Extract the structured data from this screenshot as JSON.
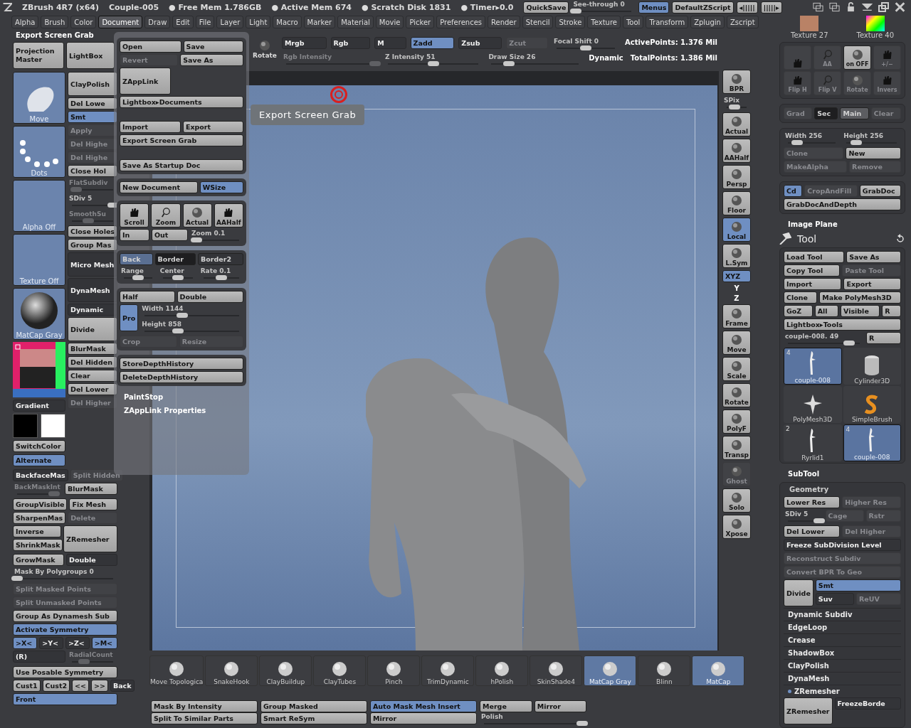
{
  "title_bar": {
    "app": "ZBrush 4R7 (x64)",
    "document": "Couple-005",
    "stats": [
      "● Free Mem 1.786GB",
      "● Active Mem 674",
      "● Scratch Disk 1831",
      "● Timer▸0.0"
    ],
    "controls": [
      {
        "kind": "button",
        "label": "QuickSave",
        "disabled": false
      },
      {
        "kind": "slider",
        "label": "See-through",
        "value": "0",
        "level": 0.0,
        "disabled": false
      },
      {
        "kind": "toggle",
        "label": "Menus",
        "on": true
      },
      {
        "kind": "button",
        "label": "DefaultZScript",
        "disabled": false
      },
      {
        "kind": "button",
        "label": "◂|||||",
        "disabled": false
      },
      {
        "kind": "button",
        "label": "|||||▸",
        "disabled": false
      }
    ]
  },
  "menu_bar": [
    {
      "label": "Alpha",
      "selected": false
    },
    {
      "label": "Brush",
      "selected": false
    },
    {
      "label": "Color",
      "selected": false
    },
    {
      "label": "Document",
      "selected": true
    },
    {
      "label": "Draw",
      "selected": false
    },
    {
      "label": "Edit",
      "selected": false
    },
    {
      "label": "File",
      "selected": false
    },
    {
      "label": "Layer",
      "selected": false
    },
    {
      "label": "Light",
      "selected": false
    },
    {
      "label": "Macro",
      "selected": false
    },
    {
      "label": "Marker",
      "selected": false
    },
    {
      "label": "Material",
      "selected": false
    },
    {
      "label": "Movie",
      "selected": false
    },
    {
      "label": "Picker",
      "selected": false
    },
    {
      "label": "Preferences",
      "selected": false
    },
    {
      "label": "Render",
      "selected": false
    },
    {
      "label": "Stencil",
      "selected": false
    },
    {
      "label": "Stroke",
      "selected": false
    },
    {
      "label": "Texture",
      "selected": false
    },
    {
      "label": "Tool",
      "selected": false
    },
    {
      "label": "Transform",
      "selected": false
    },
    {
      "label": "Zplugin",
      "selected": false
    },
    {
      "label": "Zscript",
      "selected": false
    }
  ],
  "left_palette": {
    "title": "Export Screen Grab",
    "top_row": [
      {
        "kind": "bigbutton",
        "label": "Projection Master",
        "disabled": false
      },
      {
        "kind": "bigbutton",
        "label": "LightBox",
        "disabled": false
      }
    ],
    "thumbnails": [
      {
        "kind": "brush-thumb",
        "label": "Move"
      },
      {
        "kind": "stroke-thumb",
        "label": "Dots"
      },
      {
        "kind": "alpha-thumb",
        "label": "Alpha Off"
      },
      {
        "kind": "texture-thumb",
        "label": "Texture Off"
      },
      {
        "kind": "material-thumb",
        "label": "MatCap Gray"
      },
      {
        "kind": "color-picker"
      },
      {
        "kind": "toggle",
        "label": "Gradient",
        "on": false
      },
      {
        "kind": "swatches"
      },
      {
        "kind": "button",
        "label": "SwitchColor",
        "disabled": false
      },
      {
        "kind": "toggle",
        "label": "Alternate",
        "on": true
      }
    ],
    "side_column": [
      {
        "kind": "bigbutton",
        "label": "ClayPolish",
        "disabled": false
      },
      {
        "kind": "button",
        "label": "Del Lowe",
        "disabled": false
      },
      {
        "kind": "toggle",
        "label": "Smt",
        "on": true
      },
      {
        "kind": "button",
        "label": "Apply",
        "disabled": true
      },
      {
        "kind": "button",
        "label": "Del Highe",
        "disabled": true
      },
      {
        "kind": "button",
        "label": "Del Highe",
        "disabled": true
      },
      {
        "kind": "button",
        "label": "Close Hol",
        "disabled": false
      },
      {
        "kind": "slider",
        "label": "FlatSubdiv",
        "level": 0.1,
        "disabled": true
      },
      {
        "kind": "slider",
        "label": "SDiv",
        "value": "5",
        "level": 1.0,
        "disabled": false
      },
      {
        "kind": "slider",
        "label": "SmoothSu",
        "level": 0.4,
        "disabled": true
      },
      {
        "kind": "button",
        "label": "Close Holes",
        "disabled": false
      },
      {
        "kind": "button",
        "label": "Group Mas",
        "disabled": false
      },
      {
        "kind": "bigtoggle",
        "label": "Micro Mesh",
        "on": false
      },
      {
        "kind": "bigtoggle",
        "label": "DynaMesh",
        "on": false
      },
      {
        "kind": "toggle",
        "label": "Dynamic",
        "on": false
      },
      {
        "kind": "bigbutton",
        "label": "Divide",
        "disabled": false
      },
      {
        "kind": "button",
        "label": "BlurMask",
        "disabled": false
      },
      {
        "kind": "button",
        "label": "Del Hidden",
        "disabled": false
      },
      {
        "kind": "button",
        "label": "Clear",
        "disabled": false
      },
      {
        "kind": "button",
        "label": "Del Lower",
        "disabled": false
      },
      {
        "kind": "button",
        "label": "Del Higher",
        "disabled": true
      }
    ],
    "lower_rows": [
      [
        {
          "kind": "toggle",
          "label": "BackfaceMas",
          "on": false
        },
        {
          "kind": "button",
          "label": "Split Hidden",
          "disabled": true
        }
      ],
      [
        {
          "kind": "slider",
          "label": "BackMaskInt",
          "level": 0.9,
          "disabled": true
        },
        {
          "kind": "button",
          "label": "BlurMask",
          "disabled": false
        }
      ],
      [
        {
          "kind": "button",
          "label": "GroupVisible",
          "disabled": false
        },
        {
          "kind": "button",
          "label": "Fix Mesh",
          "disabled": false
        }
      ],
      [
        {
          "kind": "button",
          "label": "SharpenMas",
          "disabled": false
        },
        {
          "kind": "button",
          "label": "Delete",
          "disabled": true
        }
      ],
      [
        {
          "kind": "stack",
          "rows": [
            [
              {
                "kind": "button",
                "label": "Inverse",
                "disabled": false
              }
            ],
            [
              {
                "kind": "button",
                "label": "ShrinkMask",
                "disabled": false
              }
            ]
          ]
        },
        {
          "kind": "bigbutton",
          "label": "ZRemesher",
          "disabled": false
        }
      ],
      [
        {
          "kind": "button",
          "label": "GrowMask",
          "disabled": false
        },
        {
          "kind": "toggle",
          "label": "Double",
          "on": false
        }
      ],
      [
        {
          "kind": "slider",
          "label": "Mask By Polygroups",
          "value": "0",
          "level": 0.0,
          "disabled": false
        }
      ],
      [
        {
          "kind": "button",
          "label": "Split Masked Points",
          "disabled": true
        }
      ],
      [
        {
          "kind": "button",
          "label": "Split Unmasked Points",
          "disabled": true
        }
      ],
      [
        {
          "kind": "button",
          "label": "Group As Dynamesh Sub",
          "disabled": false
        }
      ],
      [
        {
          "kind": "toggle",
          "label": "Activate Symmetry",
          "on": true
        }
      ],
      [
        {
          "kind": "toggle",
          "label": ">X<",
          "on": true
        },
        {
          "kind": "toggle",
          "label": ">Y<",
          "on": false
        },
        {
          "kind": "toggle",
          "label": ">Z<",
          "on": false
        },
        {
          "kind": "toggle",
          "label": ">M<",
          "on": true
        }
      ],
      [
        {
          "kind": "toggle",
          "label": "(R)",
          "on": false
        },
        {
          "kind": "slider",
          "label": "RadialCount",
          "level": 0.3,
          "disabled": true
        }
      ],
      [
        {
          "kind": "button",
          "label": "Use Posable Symmetry",
          "disabled": false
        }
      ],
      [
        {
          "kind": "button",
          "label": "Cust1",
          "disabled": false
        },
        {
          "kind": "button",
          "label": "Cust2",
          "disabled": false
        },
        {
          "kind": "button",
          "label": "<<",
          "disabled": false
        },
        {
          "kind": "button",
          "label": ">>",
          "disabled": false
        },
        {
          "kind": "toggle",
          "label": "Back",
          "on": false
        }
      ],
      [
        {
          "kind": "toggle",
          "label": "Front",
          "on": true
        }
      ]
    ]
  },
  "document_popup": {
    "groups": [
      [
        [
          {
            "kind": "button",
            "label": "Open",
            "disabled": false
          },
          {
            "kind": "button",
            "label": "Save",
            "disabled": false
          }
        ],
        [
          {
            "kind": "button",
            "label": "Revert",
            "disabled": true
          },
          {
            "kind": "button",
            "label": "Save As",
            "disabled": false
          }
        ],
        [
          {
            "kind": "bigbutton",
            "label": "ZAppLink",
            "disabled": false
          }
        ],
        [
          {
            "kind": "button",
            "label": "Lightbox▸Documents",
            "disabled": false
          }
        ],
        [
          {
            "kind": "gap"
          }
        ],
        [
          {
            "kind": "button",
            "label": "Import",
            "disabled": false
          },
          {
            "kind": "button",
            "label": "Export",
            "disabled": false
          }
        ],
        [
          {
            "kind": "button",
            "label": "Export Screen Grab",
            "disabled": false
          }
        ],
        [
          {
            "kind": "gap"
          }
        ],
        [
          {
            "kind": "button",
            "label": "Save As Startup Doc",
            "disabled": false
          }
        ]
      ],
      [
        [
          {
            "kind": "button",
            "label": "New Document",
            "disabled": false
          },
          {
            "kind": "toggle",
            "label": "WSize",
            "on": true
          }
        ]
      ],
      [
        [
          {
            "kind": "iconbutton",
            "label": "Scroll",
            "on": false,
            "disabled": false
          },
          {
            "kind": "iconbutton",
            "label": "Zoom",
            "on": false,
            "disabled": false
          },
          {
            "kind": "iconbutton",
            "label": "Actual",
            "on": false,
            "disabled": false
          },
          {
            "kind": "iconbutton",
            "label": "AAHalf",
            "on": false,
            "disabled": false
          }
        ],
        [
          {
            "kind": "button",
            "label": "In",
            "disabled": false
          },
          {
            "kind": "button",
            "label": "Out",
            "disabled": false
          },
          {
            "kind": "slider",
            "label": "Zoom",
            "value": "0.1",
            "level": 0.05,
            "disabled": false
          }
        ]
      ],
      [
        [
          {
            "kind": "swatch",
            "label": "Back",
            "color": "#5a6f92"
          },
          {
            "kind": "swatch",
            "label": "Border",
            "color": "#1e1e20"
          },
          {
            "kind": "swatch",
            "label": "Border2",
            "color": "#333438"
          }
        ],
        [
          {
            "kind": "slider",
            "label": "Range",
            "level": 0.5,
            "disabled": false
          },
          {
            "kind": "slider",
            "label": "Center",
            "level": 0.5,
            "disabled": false
          },
          {
            "kind": "slider",
            "label": "Rate",
            "value": "0.1",
            "level": 0.5,
            "disabled": false
          }
        ]
      ],
      [
        [
          {
            "kind": "button",
            "label": "Half",
            "disabled": false
          },
          {
            "kind": "button",
            "label": "Double",
            "disabled": false
          }
        ],
        [
          {
            "kind": "bigtoggle",
            "label": "Pro",
            "on": true
          },
          {
            "kind": "stack",
            "rows": [
              [
                {
                  "kind": "slider",
                  "label": "Width",
                  "value": "1144",
                  "level": 0.4,
                  "disabled": false
                }
              ],
              [
                {
                  "kind": "slider",
                  "label": "Height",
                  "value": "858",
                  "level": 0.35,
                  "disabled": false
                }
              ]
            ]
          }
        ],
        [
          {
            "kind": "button",
            "label": "Crop",
            "disabled": true
          },
          {
            "kind": "button",
            "label": "Resize",
            "disabled": true
          }
        ]
      ],
      [
        [
          {
            "kind": "button",
            "label": "StoreDepthHistory",
            "disabled": false
          }
        ],
        [
          {
            "kind": "button",
            "label": "DeleteDepthHistory",
            "disabled": false
          }
        ]
      ]
    ],
    "footer": [
      "PaintStop",
      "ZAppLink Properties"
    ]
  },
  "top_toolbar": {
    "rotate": {
      "kind": "iconlink",
      "label": "Rotate"
    },
    "row_1": [
      {
        "kind": "toggle",
        "label": "Mrgb",
        "on": false
      },
      {
        "kind": "toggle",
        "label": "Rgb",
        "on": false
      },
      {
        "kind": "toggle",
        "label": "M",
        "on": false
      },
      {
        "kind": "toggle",
        "label": "Zadd",
        "on": true
      },
      {
        "kind": "toggle",
        "label": "Zsub",
        "on": false
      },
      {
        "kind": "button",
        "label": "Zcut",
        "disabled": true
      },
      {
        "kind": "slider",
        "label": "Focal Shift",
        "value": "0",
        "level": 0.5,
        "disabled": false
      },
      {
        "kind": "text",
        "label": "ActivePoints: 1.376  Mil"
      }
    ],
    "row_2": [
      {
        "kind": "slider",
        "label": "Rgb Intensity",
        "level": 1.0,
        "disabled": true
      },
      {
        "kind": "slider",
        "label": "Z Intensity",
        "value": "51",
        "level": 0.5,
        "disabled": false
      },
      {
        "kind": "slider",
        "label": "Draw  Size",
        "value": "26",
        "level": 0.2,
        "disabled": false
      },
      {
        "kind": "text",
        "label": "Dynamic"
      },
      {
        "kind": "text",
        "label": "TotalPoints: 1.386  Mil"
      }
    ]
  },
  "canvas": {
    "tooltip": "Export Screen Grab"
  },
  "brush_shelf": [
    {
      "label": "Move  Topologica",
      "selected": false
    },
    {
      "label": "SnakeHook",
      "selected": false
    },
    {
      "label": "ClayBuildup",
      "selected": false
    },
    {
      "label": "ClayTubes",
      "selected": false
    },
    {
      "label": "Pinch",
      "selected": false
    },
    {
      "label": "TrimDynamic",
      "selected": false
    },
    {
      "label": "hPolish",
      "selected": false
    },
    {
      "label": "SkinShade4",
      "selected": false
    },
    {
      "label": "MatCap  Gray",
      "selected": true
    },
    {
      "label": "Blinn",
      "selected": false
    },
    {
      "label": "MatCap",
      "selected": true
    }
  ],
  "bottom_bar": [
    [
      [
        {
          "kind": "button",
          "label": "Mask By Intensity",
          "disabled": false
        }
      ],
      [
        {
          "kind": "button",
          "label": "Split To Similar Parts",
          "disabled": false
        }
      ]
    ],
    [
      [
        {
          "kind": "button",
          "label": "Group Masked",
          "disabled": false
        }
      ],
      [
        {
          "kind": "button",
          "label": "Smart ReSym",
          "disabled": false
        }
      ]
    ],
    [
      [
        {
          "kind": "toggle",
          "label": "Auto Mask Mesh Insert",
          "on": true
        }
      ],
      [
        {
          "kind": "button",
          "label": "Mirror",
          "disabled": false
        }
      ]
    ],
    [
      [
        {
          "kind": "button",
          "label": "Merge",
          "disabled": false
        },
        {
          "kind": "button",
          "label": "Mirror",
          "disabled": false
        }
      ],
      [
        {
          "kind": "slider",
          "label": "Polish",
          "level": 1.0,
          "disabled": false
        }
      ]
    ]
  ],
  "right_toolbar": [
    {
      "kind": "iconbutton",
      "label": "BPR",
      "on": false,
      "disabled": false
    },
    {
      "kind": "slider",
      "label": "SPix",
      "level": 0.4,
      "disabled": false
    },
    {
      "kind": "iconbutton",
      "label": "Actual",
      "on": false,
      "disabled": false
    },
    {
      "kind": "iconbutton",
      "label": "AAHalf",
      "on": false,
      "disabled": false
    },
    {
      "kind": "iconbutton",
      "label": "Persp",
      "on": false,
      "disabled": false
    },
    {
      "kind": "iconbutton",
      "label": "Floor",
      "on": false,
      "disabled": false
    },
    {
      "kind": "iconbutton",
      "label": "Local",
      "on": true,
      "disabled": false
    },
    {
      "kind": "iconbutton",
      "label": "L.Sym",
      "on": false,
      "disabled": false
    },
    {
      "kind": "toggle",
      "label": "XYZ",
      "on": true
    },
    {
      "kind": "text",
      "label": "Y"
    },
    {
      "kind": "text",
      "label": "Z"
    },
    {
      "kind": "iconbutton",
      "label": "Frame",
      "on": false,
      "disabled": false
    },
    {
      "kind": "iconbutton",
      "label": "Move",
      "on": false,
      "disabled": false
    },
    {
      "kind": "iconbutton",
      "label": "Scale",
      "on": false,
      "disabled": false
    },
    {
      "kind": "iconbutton",
      "label": "Rotate",
      "on": false,
      "disabled": false
    },
    {
      "kind": "iconbutton",
      "label": "PolyF",
      "on": false,
      "disabled": false
    },
    {
      "kind": "iconbutton",
      "label": "Transp",
      "on": false,
      "disabled": false
    },
    {
      "kind": "iconbutton",
      "label": "Ghost",
      "on": false,
      "disabled": true
    },
    {
      "kind": "iconbutton",
      "label": "Solo",
      "on": false,
      "disabled": false
    },
    {
      "kind": "iconbutton",
      "label": "Xpose",
      "on": false,
      "disabled": false
    }
  ],
  "right_panel": {
    "textures": [
      {
        "kind": "texture-thumb",
        "label": "Texture 27"
      },
      {
        "kind": "gradient-thumb",
        "label": "Texture 40"
      }
    ],
    "groups": [
      [
        [
          {
            "kind": "iconbutton",
            "on": false,
            "disabled": true
          },
          {
            "kind": "iconbutton",
            "label": "AA",
            "on": false,
            "disabled": true
          },
          {
            "kind": "iconbutton",
            "label": "on OFF",
            "on": false,
            "disabled": false
          },
          {
            "kind": "iconbutton",
            "label": "+/−",
            "on": false,
            "disabled": true
          }
        ],
        [
          {
            "kind": "iconbutton",
            "label": "Flip H",
            "on": false,
            "disabled": true
          },
          {
            "kind": "iconbutton",
            "label": "Flip V",
            "on": false,
            "disabled": true
          },
          {
            "kind": "iconbutton",
            "label": "Rotate",
            "on": false,
            "disabled": true
          },
          {
            "kind": "iconbutton",
            "label": "Invers",
            "on": false,
            "disabled": true
          }
        ]
      ],
      [
        [
          {
            "kind": "button",
            "label": "Grad",
            "disabled": true
          },
          {
            "kind": "swatch",
            "label": "Sec",
            "color": "#1e1e20"
          },
          {
            "kind": "swatch",
            "label": "Main",
            "color": "#5c5d61"
          },
          {
            "kind": "button",
            "label": "Clear",
            "disabled": true
          }
        ]
      ],
      [
        [
          {
            "kind": "slider",
            "label": "Width",
            "value": "256",
            "level": 0.2,
            "disabled": false
          },
          {
            "kind": "slider",
            "label": "Height",
            "value": "256",
            "level": 0.2,
            "disabled": false
          }
        ],
        [
          {
            "kind": "button",
            "label": "Clone",
            "disabled": true
          },
          {
            "kind": "button",
            "label": "New",
            "disabled": false
          }
        ],
        [
          {
            "kind": "button",
            "label": "MakeAlpha",
            "disabled": true
          },
          {
            "kind": "button",
            "label": "Remove",
            "disabled": true
          }
        ]
      ],
      [
        [
          {
            "kind": "toggle",
            "label": "Cd",
            "on": true
          },
          {
            "kind": "button",
            "label": "CropAndFill",
            "disabled": true
          },
          {
            "kind": "button",
            "label": "GrabDoc",
            "disabled": false
          }
        ],
        [
          {
            "kind": "button",
            "label": "GrabDocAndDepth",
            "disabled": false
          }
        ]
      ]
    ],
    "image_plane": "Image Plane",
    "tool_title": "Tool",
    "tool_rows": [
      [
        {
          "kind": "button",
          "label": "Load Tool",
          "disabled": false
        },
        {
          "kind": "button",
          "label": "Save As",
          "disabled": false
        }
      ],
      [
        {
          "kind": "button",
          "label": "Copy Tool",
          "disabled": false
        },
        {
          "kind": "button",
          "label": "Paste Tool",
          "disabled": true
        }
      ],
      [
        {
          "kind": "button",
          "label": "Import",
          "disabled": false
        },
        {
          "kind": "button",
          "label": "Export",
          "disabled": false
        }
      ],
      [
        {
          "kind": "button",
          "label": "Clone",
          "disabled": false
        },
        {
          "kind": "button",
          "label": "Make PolyMesh3D",
          "disabled": false
        }
      ],
      [
        {
          "kind": "button",
          "label": "GoZ",
          "disabled": false
        },
        {
          "kind": "button",
          "label": "All",
          "disabled": false
        },
        {
          "kind": "button",
          "label": "Visible",
          "disabled": false
        },
        {
          "kind": "button",
          "label": "R",
          "disabled": false
        }
      ],
      [
        {
          "kind": "button",
          "label": "Lightbox▸Tools",
          "disabled": false
        }
      ],
      [
        {
          "kind": "slider",
          "label": "couple-008.",
          "value": "49",
          "level": 0.85,
          "disabled": false
        },
        {
          "kind": "button",
          "label": "R",
          "disabled": false
        }
      ]
    ],
    "tools": [
      {
        "label": "couple-008",
        "count": "4",
        "selected": true
      },
      {
        "label": "Cylinder3D",
        "selected": false
      },
      {
        "label": "PolyMesh3D",
        "selected": false
      },
      {
        "label": "SimpleBrush",
        "selected": false
      },
      {
        "label": "Ryrlid1",
        "count": "2",
        "selected": false
      },
      {
        "label": "couple-008",
        "count": "4",
        "selected": true
      }
    ],
    "subtool": "SubTool",
    "geometry_title": "Geometry",
    "geometry_rows": [
      [
        {
          "kind": "button",
          "label": "Lower Res",
          "disabled": false
        },
        {
          "kind": "button",
          "label": "Higher Res",
          "disabled": true
        }
      ],
      [
        {
          "kind": "slider",
          "label": "SDiv",
          "value": "5",
          "level": 1.0,
          "disabled": false
        },
        {
          "kind": "button",
          "label": "Cage",
          "disabled": true
        },
        {
          "kind": "button",
          "label": "Rstr",
          "disabled": true
        }
      ],
      [
        {
          "kind": "button",
          "label": "Del Lower",
          "disabled": false
        },
        {
          "kind": "button",
          "label": "Del Higher",
          "disabled": true
        }
      ],
      [
        {
          "kind": "toggle",
          "label": "Freeze SubDivision Level",
          "on": false
        }
      ],
      [
        {
          "kind": "button",
          "label": "Reconstruct Subdiv",
          "disabled": true
        }
      ],
      [
        {
          "kind": "button",
          "label": "Convert BPR To Geo",
          "disabled": true
        }
      ],
      [
        {
          "kind": "bigbutton",
          "label": "Divide",
          "disabled": false
        },
        {
          "kind": "stack",
          "rows": [
            [
              {
                "kind": "toggle",
                "label": "Smt",
                "on": true
              }
            ],
            [
              {
                "kind": "toggle",
                "label": "Suv",
                "on": false
              },
              {
                "kind": "button",
                "label": "ReUV",
                "disabled": true
              }
            ]
          ]
        }
      ]
    ],
    "sections": [
      {
        "label": "Dynamic Subdiv",
        "marked": false
      },
      {
        "label": "EdgeLoop",
        "marked": false
      },
      {
        "label": "Crease",
        "marked": false
      },
      {
        "label": "ShadowBox",
        "marked": false
      },
      {
        "label": "ClayPolish",
        "marked": false
      },
      {
        "label": "DynaMesh",
        "marked": false
      },
      {
        "label": "ZRemesher",
        "marked": true
      }
    ],
    "last_row": [
      {
        "kind": "bigbutton",
        "label": "ZRemesher",
        "disabled": false
      },
      {
        "kind": "toggle",
        "label": "FreezeBorde",
        "on": false
      }
    ]
  }
}
